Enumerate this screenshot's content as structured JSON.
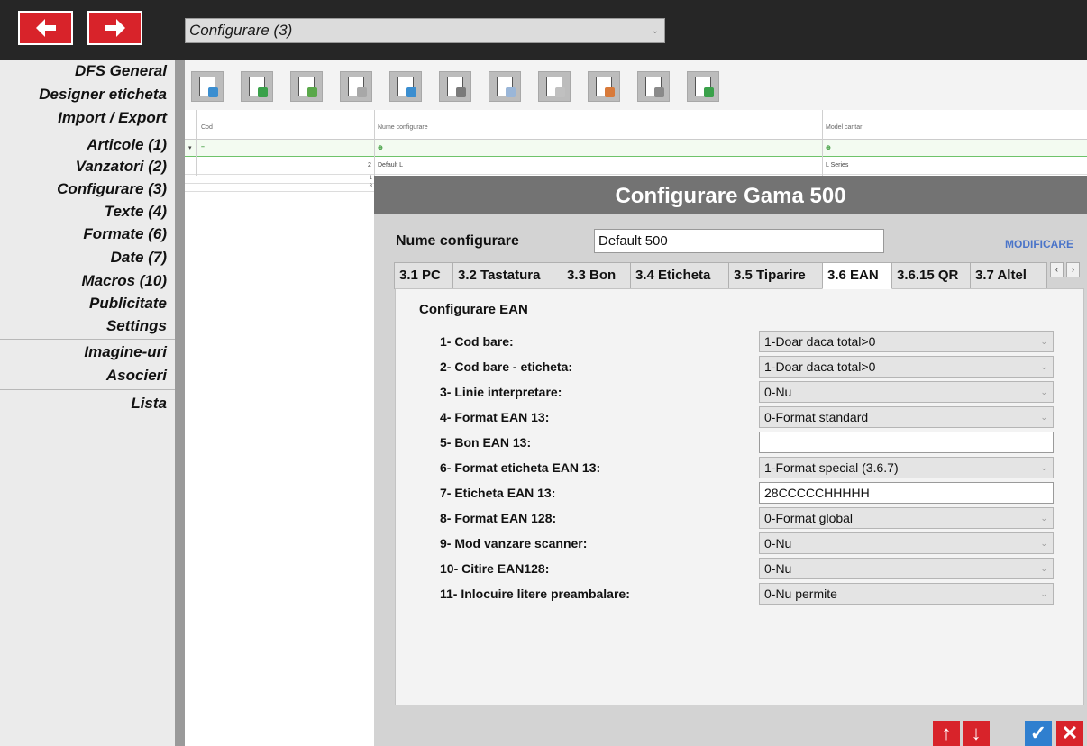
{
  "header": {
    "configuration_combo_value": "Configurare (3)"
  },
  "sidebar": {
    "items": [
      "DFS General",
      "Designer eticheta",
      "Import / Export",
      "Articole (1)",
      "Vanzatori (2)",
      "Configurare (3)",
      "Texte (4)",
      "Formate (6)",
      "Date (7)",
      "Macros (10)",
      "Publicitate",
      "Settings",
      "Imagine-uri",
      "Asocieri",
      "Lista"
    ]
  },
  "toolbar": {
    "icons": [
      "view-icon",
      "export-icon",
      "edit-icon",
      "delete-icon",
      "refresh-icon",
      "copy-icon",
      "columns-icon",
      "list-icon",
      "print-preview-icon",
      "print-icon",
      "exit-icon"
    ]
  },
  "grid": {
    "columns": [
      "Cod",
      "Nume configurare",
      "Model cantar"
    ],
    "new_row": {
      "cod": "–",
      "nume": "⊕",
      "model": "⊕"
    },
    "rows": [
      {
        "cod": "2",
        "nume": "Default L",
        "model": "L Series"
      }
    ],
    "left_rows": [
      "1",
      "3"
    ]
  },
  "dialog": {
    "title": "Configurare Gama 500",
    "name_label": "Nume configurare",
    "name_value": "Default 500",
    "modify_link": "MODIFICARE",
    "tabs": [
      "3.1 PC",
      "3.2 Tastatura",
      "3.3 Bon",
      "3.4 Eticheta",
      "3.5 Tiparire",
      "3.6 EAN",
      "3.6.15 QR",
      "3.7 Altel"
    ],
    "active_tab": "3.6 EAN",
    "tab_arrows": [
      "‹",
      "›"
    ],
    "panel_title": "Configurare EAN",
    "fields": [
      {
        "label": "1- Cod bare:",
        "type": "select",
        "value": "1-Doar daca total>0"
      },
      {
        "label": "2- Cod bare - eticheta:",
        "type": "select",
        "value": "1-Doar daca total>0"
      },
      {
        "label": "3- Linie interpretare:",
        "type": "select",
        "value": "0-Nu"
      },
      {
        "label": "4- Format EAN 13:",
        "type": "select",
        "value": "0-Format standard"
      },
      {
        "label": "5- Bon EAN 13:",
        "type": "input",
        "value": ""
      },
      {
        "label": "6- Format eticheta EAN 13:",
        "type": "select",
        "value": "1-Format special (3.6.7)"
      },
      {
        "label": "7- Eticheta EAN 13:",
        "type": "input",
        "value": "28CCCCCHHHHH"
      },
      {
        "label": "8- Format EAN 128:",
        "type": "select",
        "value": "0-Format global"
      },
      {
        "label": "9- Mod vanzare scanner:",
        "type": "select",
        "value": "0-Nu"
      },
      {
        "label": "10- Citire EAN128:",
        "type": "select",
        "value": "0-Nu"
      },
      {
        "label": "11- Inlocuire litere preambalare:",
        "type": "select",
        "value": "0-Nu permite"
      }
    ]
  },
  "actions": {
    "up": "↑",
    "down": "↓",
    "ok": "✓",
    "cancel": "✕"
  },
  "colors": {
    "accent_red": "#d8232a",
    "accent_blue": "#2f7fcf",
    "link_blue": "#4a74c9",
    "title_bar": "#737373"
  }
}
